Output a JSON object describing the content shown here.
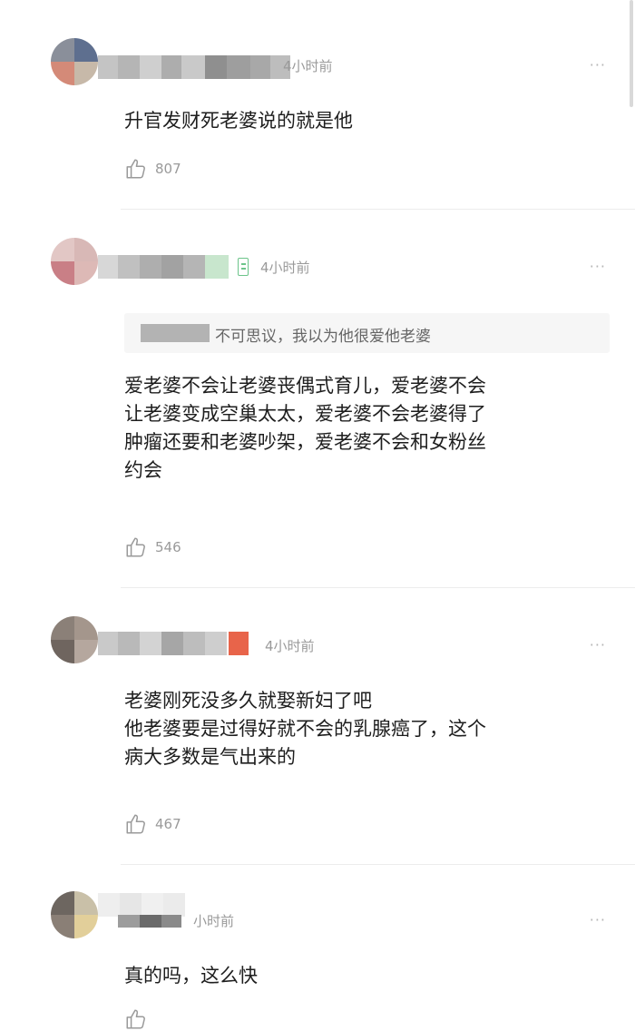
{
  "comments": [
    {
      "time": "4小时前",
      "more": "···",
      "lines": [
        "升官发财死老婆说的就是他"
      ],
      "likes": "807"
    },
    {
      "time": "4小时前",
      "more": "···",
      "quote": "不可思议，我以为他很爱他老婆",
      "lines": [
        "爱老婆不会让老婆丧偶式育儿，爱老婆不会",
        "让老婆变成空巢太太，爱老婆不会老婆得了",
        "肿瘤还要和老婆吵架，爱老婆不会和女粉丝",
        "约会"
      ],
      "likes": "546"
    },
    {
      "time": "4小时前",
      "more": "···",
      "lines": [
        "老婆刚死没多久就娶新妇了吧",
        "他老婆要是过得好就不会的乳腺癌了，这个",
        "病大多数是气出来的"
      ],
      "likes": "467"
    },
    {
      "time": "小时前",
      "more": "···",
      "lines": [
        "真的吗，这么快"
      ]
    }
  ],
  "colors": {
    "like_icon": "#9a9a9a",
    "level_icon": "#6cc48a",
    "tag": "#e8644a"
  },
  "icons": {
    "like": "thumbs-up-icon",
    "more": "more-dots-icon",
    "level": "level-badge-icon"
  }
}
